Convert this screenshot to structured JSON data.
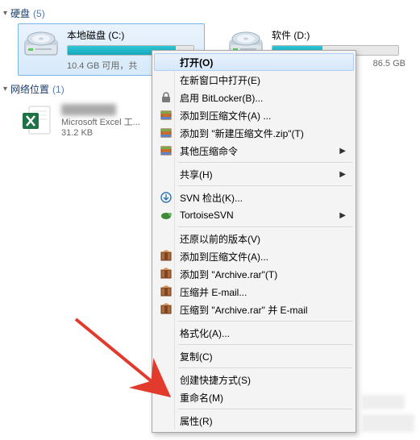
{
  "groups": {
    "drives": {
      "title": "硬盘",
      "count": "(5)"
    },
    "network": {
      "title": "网络位置",
      "count": "(1)"
    }
  },
  "drives": [
    {
      "name": "本地磁盘 (C:)",
      "free": "10.4 GB 可用，共",
      "fill_pct": 86
    },
    {
      "name": "软件 (D:)",
      "free": "86.5 GB",
      "fill_pct": 40
    }
  ],
  "file": {
    "name_blurred": "████████",
    "meta1": "Microsoft Excel 工...",
    "meta2": "31.2 KB"
  },
  "menu": {
    "open": "打开(O)",
    "open_new": "在新窗口中打开(E)",
    "bitlocker": "启用 BitLocker(B)...",
    "add_archive": "添加到压缩文件(A) ...",
    "add_to_zip": "添加到 \"新建压缩文件.zip\"(T)",
    "other_archive": "其他压缩命令",
    "share": "共享(H)",
    "svn_checkout": "SVN 检出(K)...",
    "tortoise": "TortoiseSVN",
    "prev_versions": "还原以前的版本(V)",
    "add_archive2": "添加到压缩文件(A)...",
    "add_to_rar": "添加到 \"Archive.rar\"(T)",
    "compress_email": "压缩并 E-mail...",
    "compress_rar_email": "压缩到 \"Archive.rar\" 并 E-mail",
    "format": "格式化(A)...",
    "copy": "复制(C)",
    "create_shortcut": "创建快捷方式(S)",
    "rename": "重命名(M)",
    "properties": "属性(R)"
  }
}
